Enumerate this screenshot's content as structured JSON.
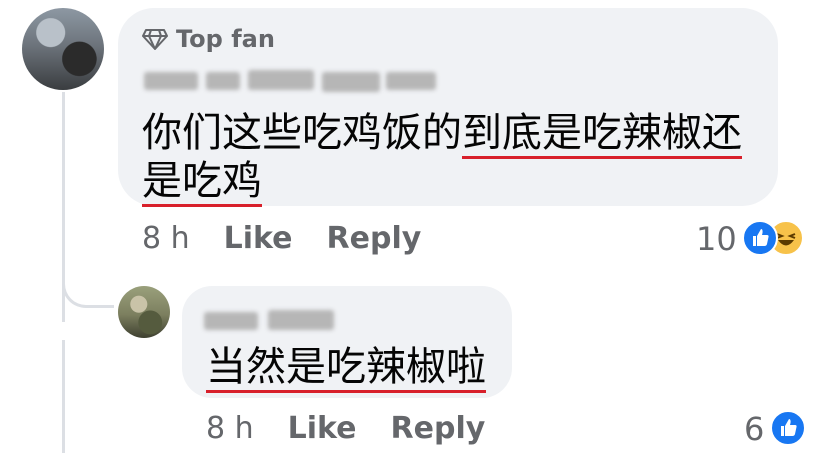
{
  "comment": {
    "badge": "Top fan",
    "text_line1_plain": "你们这些吃鸡饭的",
    "text_line1_underlined": "到底是吃辣椒还",
    "text_line2_underlined": "是吃鸡",
    "time": "8 h",
    "like_label": "Like",
    "reply_label": "Reply",
    "reaction_count": "10",
    "reactions": [
      "like-icon",
      "haha-icon"
    ]
  },
  "reply": {
    "text_underlined": "当然是吃辣椒啦",
    "time": "8 h",
    "like_label": "Like",
    "reply_label": "Reply",
    "reaction_count": "6",
    "reactions": [
      "like-icon"
    ]
  },
  "colors": {
    "bubble": "#f0f2f5",
    "meta": "#65676b",
    "underline": "#d8202b",
    "like_blue": "#1877f2",
    "haha_yellow": "#f7c24a"
  }
}
